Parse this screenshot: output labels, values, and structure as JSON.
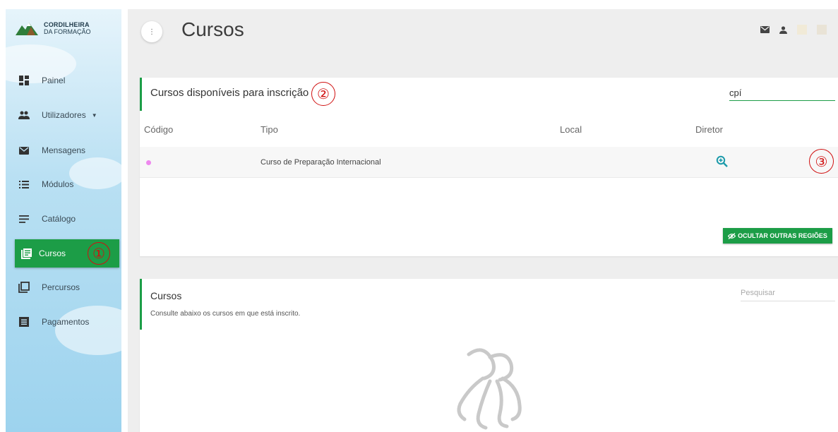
{
  "sidebar": {
    "brand_line1": "CORDILHEIRA",
    "brand_line2": "DA FORMAÇÃO",
    "items": [
      {
        "label": "Painel",
        "icon": "dashboard-icon"
      },
      {
        "label": "Utilizadores",
        "icon": "people-icon"
      },
      {
        "label": "Mensagens",
        "icon": "mail-icon"
      },
      {
        "label": "Módulos",
        "icon": "list-icon"
      },
      {
        "label": "Catálogo",
        "icon": "lines-icon"
      },
      {
        "label": "Cursos",
        "icon": "courses-icon"
      },
      {
        "label": "Percursos",
        "icon": "copy-icon"
      },
      {
        "label": "Pagamentos",
        "icon": "receipt-icon"
      }
    ]
  },
  "header": {
    "title": "Cursos",
    "menu_icon": "⋮"
  },
  "available": {
    "title": "Cursos disponíveis para inscrição",
    "search_value": "cpí",
    "columns": [
      "Código",
      "Tipo",
      "Local",
      "Diretor"
    ],
    "rows": [
      {
        "tipo": "Curso de Preparação Internacional"
      }
    ],
    "hide_button": "OCULTAR OUTRAS REGIÕES"
  },
  "enrolled": {
    "title": "Cursos",
    "subtitle": "Consulte abaixo os cursos em que está inscrito.",
    "search_placeholder": "Pesquisar"
  },
  "annotations": [
    "①",
    "②",
    "③"
  ],
  "colors": {
    "accent": "#1c9d47",
    "annotation": "#d01010",
    "info_icon": "#1b9aaa"
  }
}
